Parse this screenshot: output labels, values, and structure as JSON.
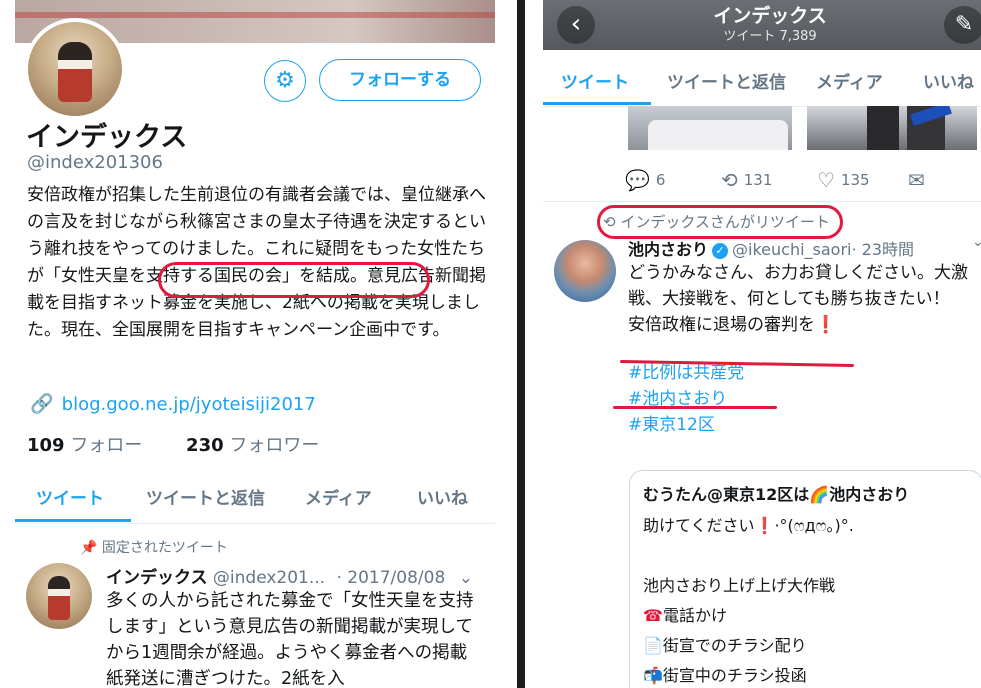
{
  "left_profile": {
    "name": "インデックス",
    "handle": "@index201306",
    "settings_icon": "gear-icon",
    "follow_button": "フォローする",
    "bio_before": "安倍政権が招集した生前退位の有識者会議では、皇位継承への言及を封じながら秋篠宮さまの皇太子待遇を決定するという離れ技をやってのけました。これに疑問をもった女性たちが",
    "bio_highlight": "「女性天皇を支持する国民の会」",
    "bio_after": "を結成。意見広告新聞掲載を目指すネット募金を実施し、2紙への掲載を実現しました。現在、全国展開を目指すキャンペーン企画中です。",
    "link_icon": "link-icon",
    "link": "blog.goo.ne.jp/jyoteisiji2017",
    "following_count": "109",
    "following_label": "フォロー",
    "followers_count": "230",
    "followers_label": "フォロワー",
    "tabs": [
      "ツイート",
      "ツイートと返信",
      "メディア",
      "いいね"
    ],
    "pinned_label": "固定されたツイート",
    "pinned_tweet": {
      "name": "インデックス",
      "handle": "@index201...",
      "date": "· 2017/08/08",
      "text": "多くの人から託された募金で「女性天皇を支持します」という意見広告の新聞掲載が実現してから1週間余が経過。ようやく募金者への掲載紙発送に漕ぎつけた。2紙を入"
    }
  },
  "right_timeline": {
    "header_title": "インデックス",
    "header_count": "ツイート 7,389",
    "tabs": [
      "ツイート",
      "ツイートと返信",
      "メディア",
      "いいね"
    ],
    "prev_tweet_actions": {
      "replies": "6",
      "retweets": "131",
      "likes": "135"
    },
    "retweet_label": "インデックスさんがリツイート",
    "tweet": {
      "name": "池内さおり",
      "handle": "@ikeuchi_saori",
      "time": "· 23時間",
      "line1": "どうかみなさん、お力お貸しください。大激戦、大接戦を、何としても勝ち抜きたい！",
      "line2": "安倍政権に退場の審判を",
      "line2_emoji": "❗",
      "hashtag1": "#比例は共産党",
      "hashtag2": "#池内さおり",
      "hashtag3": "#東京12区"
    },
    "quote": {
      "head_prefix": "むうたん@東京12区は",
      "head_emoji": "🌈",
      "head_suffix": "池内さおり",
      "line1": "助けてください",
      "line1_emoji": "❗",
      "line1_suffix": "·°(ෆдෆ。)°.",
      "line2": "池内さおり上げ上げ大作戦",
      "line3_emoji": "☎",
      "line3": "電話かけ",
      "line4_emoji": "📄",
      "line4": "街宣でのチラシ配り",
      "line5_emoji": "📬",
      "line5": "街宣中のチラシ投函"
    }
  },
  "colors": {
    "accent": "#1da1f2",
    "annotation_red": "#e0193d",
    "muted": "#657786"
  }
}
